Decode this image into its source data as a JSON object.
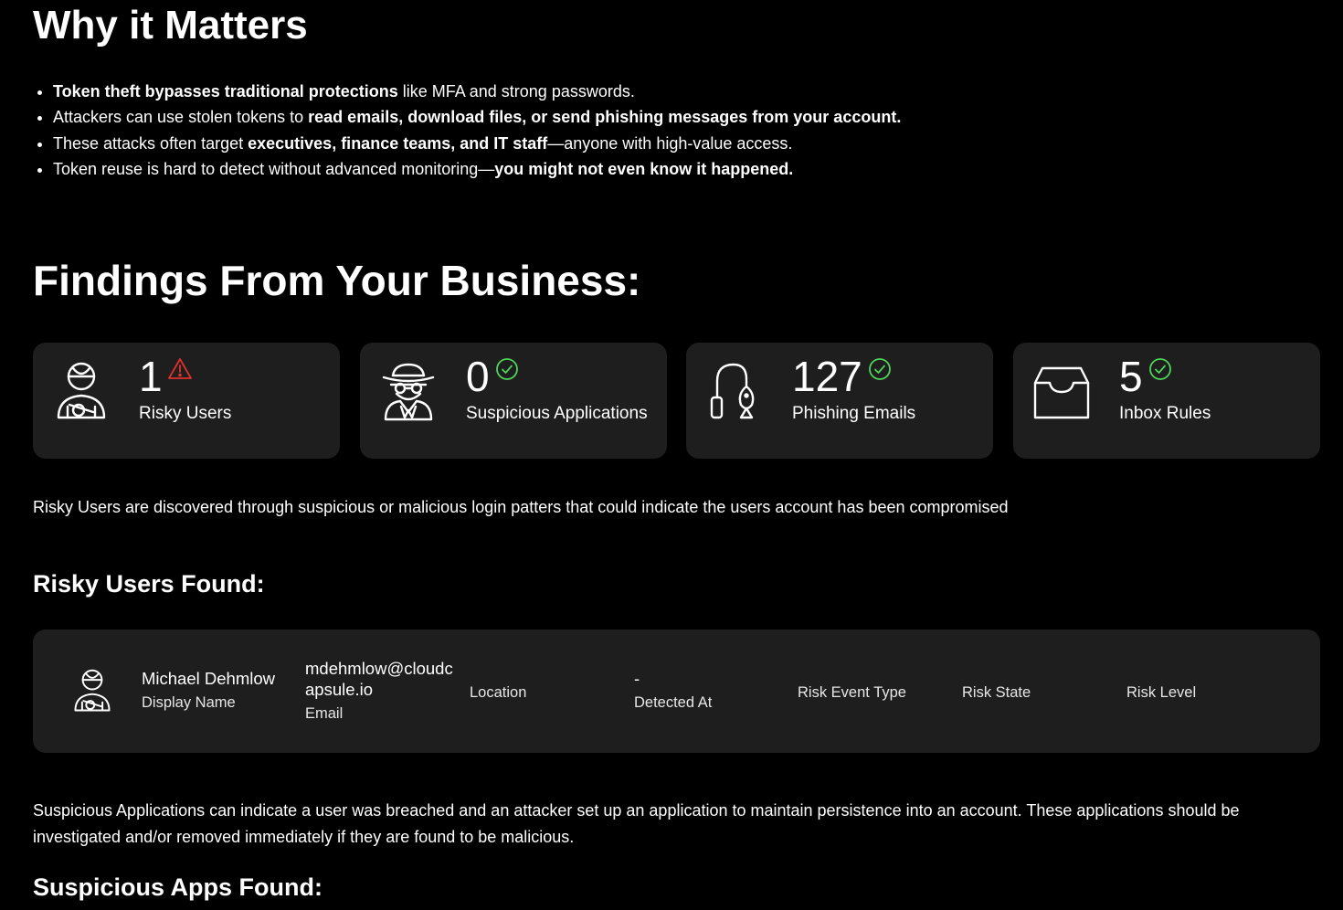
{
  "why": {
    "title": "Why it Matters",
    "bullets": [
      [
        {
          "t": "Token theft bypasses traditional protections",
          "b": true
        },
        {
          "t": " like MFA and strong passwords.",
          "b": false
        }
      ],
      [
        {
          "t": "Attackers can use stolen tokens to ",
          "b": false
        },
        {
          "t": "read emails, download files, or send phishing messages from your account.",
          "b": true
        }
      ],
      [
        {
          "t": "These attacks often target ",
          "b": false
        },
        {
          "t": "executives, finance teams, and IT staff",
          "b": true
        },
        {
          "t": "—anyone with high-value access.",
          "b": false
        }
      ],
      [
        {
          "t": " Token reuse is hard to detect without advanced monitoring—",
          "b": false
        },
        {
          "t": "you might not even know it happened.",
          "b": true
        }
      ]
    ]
  },
  "findings": {
    "title": "Findings From Your Business:",
    "cards": [
      {
        "value": "1",
        "label": "Risky Users",
        "icon": "risky-user-icon",
        "status": "warning-icon"
      },
      {
        "value": "0",
        "label": "Suspicious Applications",
        "icon": "spy-icon",
        "status": "check-icon"
      },
      {
        "value": "127",
        "label": "Phishing Emails",
        "icon": "fishing-hook-icon",
        "status": "check-icon"
      },
      {
        "value": "5",
        "label": "Inbox Rules",
        "icon": "inbox-tray-icon",
        "status": "check-icon"
      }
    ],
    "colors": {
      "warning": "#e0312b",
      "ok": "#4fd45a",
      "card": "#1e1e1e"
    }
  },
  "risky": {
    "description": "Risky Users are discovered through suspicious or malicious login patters that could indicate the users account has been compromised",
    "found_title": "Risky Users Found:",
    "user": {
      "display_name": "Michael Dehmlow",
      "display_name_key": "Display Name",
      "email_line1": "mdehmlow@cloudc",
      "email_line2": "apsule.io",
      "email_key": "Email",
      "location_key": "Location",
      "detected_value": "-",
      "detected_key": "Detected At",
      "risk_event_key": "Risk Event Type",
      "risk_state_key": "Risk State",
      "risk_level_key": "Risk Level"
    }
  },
  "apps": {
    "description": "Suspicious Applications can indicate a user was breached and an attacker set up an application to maintain persistence into an account. These applications should be investigated and/or removed immediately if they are found to be malicious.",
    "found_title": "Suspicious Apps Found:"
  }
}
